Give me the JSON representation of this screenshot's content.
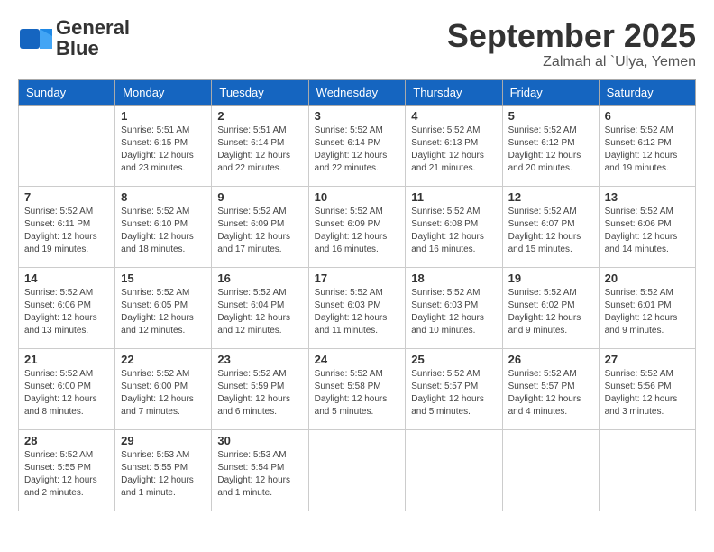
{
  "header": {
    "logo_general": "General",
    "logo_blue": "Blue",
    "month_title": "September 2025",
    "location": "Zalmah al `Ulya, Yemen"
  },
  "weekdays": [
    "Sunday",
    "Monday",
    "Tuesday",
    "Wednesday",
    "Thursday",
    "Friday",
    "Saturday"
  ],
  "weeks": [
    [
      {
        "day": "",
        "info": ""
      },
      {
        "day": "1",
        "info": "Sunrise: 5:51 AM\nSunset: 6:15 PM\nDaylight: 12 hours\nand 23 minutes."
      },
      {
        "day": "2",
        "info": "Sunrise: 5:51 AM\nSunset: 6:14 PM\nDaylight: 12 hours\nand 22 minutes."
      },
      {
        "day": "3",
        "info": "Sunrise: 5:52 AM\nSunset: 6:14 PM\nDaylight: 12 hours\nand 22 minutes."
      },
      {
        "day": "4",
        "info": "Sunrise: 5:52 AM\nSunset: 6:13 PM\nDaylight: 12 hours\nand 21 minutes."
      },
      {
        "day": "5",
        "info": "Sunrise: 5:52 AM\nSunset: 6:12 PM\nDaylight: 12 hours\nand 20 minutes."
      },
      {
        "day": "6",
        "info": "Sunrise: 5:52 AM\nSunset: 6:12 PM\nDaylight: 12 hours\nand 19 minutes."
      }
    ],
    [
      {
        "day": "7",
        "info": "Sunrise: 5:52 AM\nSunset: 6:11 PM\nDaylight: 12 hours\nand 19 minutes."
      },
      {
        "day": "8",
        "info": "Sunrise: 5:52 AM\nSunset: 6:10 PM\nDaylight: 12 hours\nand 18 minutes."
      },
      {
        "day": "9",
        "info": "Sunrise: 5:52 AM\nSunset: 6:09 PM\nDaylight: 12 hours\nand 17 minutes."
      },
      {
        "day": "10",
        "info": "Sunrise: 5:52 AM\nSunset: 6:09 PM\nDaylight: 12 hours\nand 16 minutes."
      },
      {
        "day": "11",
        "info": "Sunrise: 5:52 AM\nSunset: 6:08 PM\nDaylight: 12 hours\nand 16 minutes."
      },
      {
        "day": "12",
        "info": "Sunrise: 5:52 AM\nSunset: 6:07 PM\nDaylight: 12 hours\nand 15 minutes."
      },
      {
        "day": "13",
        "info": "Sunrise: 5:52 AM\nSunset: 6:06 PM\nDaylight: 12 hours\nand 14 minutes."
      }
    ],
    [
      {
        "day": "14",
        "info": "Sunrise: 5:52 AM\nSunset: 6:06 PM\nDaylight: 12 hours\nand 13 minutes."
      },
      {
        "day": "15",
        "info": "Sunrise: 5:52 AM\nSunset: 6:05 PM\nDaylight: 12 hours\nand 12 minutes."
      },
      {
        "day": "16",
        "info": "Sunrise: 5:52 AM\nSunset: 6:04 PM\nDaylight: 12 hours\nand 12 minutes."
      },
      {
        "day": "17",
        "info": "Sunrise: 5:52 AM\nSunset: 6:03 PM\nDaylight: 12 hours\nand 11 minutes."
      },
      {
        "day": "18",
        "info": "Sunrise: 5:52 AM\nSunset: 6:03 PM\nDaylight: 12 hours\nand 10 minutes."
      },
      {
        "day": "19",
        "info": "Sunrise: 5:52 AM\nSunset: 6:02 PM\nDaylight: 12 hours\nand 9 minutes."
      },
      {
        "day": "20",
        "info": "Sunrise: 5:52 AM\nSunset: 6:01 PM\nDaylight: 12 hours\nand 9 minutes."
      }
    ],
    [
      {
        "day": "21",
        "info": "Sunrise: 5:52 AM\nSunset: 6:00 PM\nDaylight: 12 hours\nand 8 minutes."
      },
      {
        "day": "22",
        "info": "Sunrise: 5:52 AM\nSunset: 6:00 PM\nDaylight: 12 hours\nand 7 minutes."
      },
      {
        "day": "23",
        "info": "Sunrise: 5:52 AM\nSunset: 5:59 PM\nDaylight: 12 hours\nand 6 minutes."
      },
      {
        "day": "24",
        "info": "Sunrise: 5:52 AM\nSunset: 5:58 PM\nDaylight: 12 hours\nand 5 minutes."
      },
      {
        "day": "25",
        "info": "Sunrise: 5:52 AM\nSunset: 5:57 PM\nDaylight: 12 hours\nand 5 minutes."
      },
      {
        "day": "26",
        "info": "Sunrise: 5:52 AM\nSunset: 5:57 PM\nDaylight: 12 hours\nand 4 minutes."
      },
      {
        "day": "27",
        "info": "Sunrise: 5:52 AM\nSunset: 5:56 PM\nDaylight: 12 hours\nand 3 minutes."
      }
    ],
    [
      {
        "day": "28",
        "info": "Sunrise: 5:52 AM\nSunset: 5:55 PM\nDaylight: 12 hours\nand 2 minutes."
      },
      {
        "day": "29",
        "info": "Sunrise: 5:53 AM\nSunset: 5:55 PM\nDaylight: 12 hours\nand 1 minute."
      },
      {
        "day": "30",
        "info": "Sunrise: 5:53 AM\nSunset: 5:54 PM\nDaylight: 12 hours\nand 1 minute."
      },
      {
        "day": "",
        "info": ""
      },
      {
        "day": "",
        "info": ""
      },
      {
        "day": "",
        "info": ""
      },
      {
        "day": "",
        "info": ""
      }
    ]
  ]
}
